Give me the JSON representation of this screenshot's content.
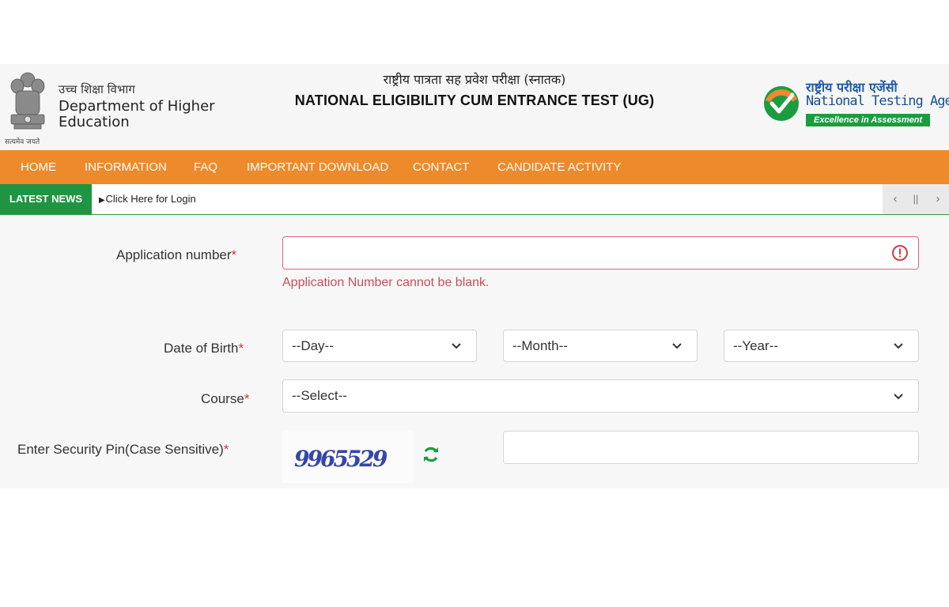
{
  "header": {
    "emblem_caption": "सत्यमेव जयते",
    "dept_hindi": "उच्च शिक्षा विभाग",
    "dept_english": "Department of Higher Education",
    "title_hindi": "राष्ट्रीय पात्रता सह प्रवेश परीक्षा (स्नातक)",
    "title_english": "NATIONAL ELIGIBILITY CUM ENTRANCE TEST (UG)",
    "nta_hindi": "राष्ट्रीय परीक्षा एजेंसी",
    "nta_english": "National Testing Agency",
    "nta_tagline": "Excellence in Assessment",
    "nta_colors": {
      "blue": "#1a5aa8",
      "green": "#1b9d3f",
      "orange": "#ec8a2c"
    }
  },
  "nav": {
    "items": [
      {
        "label": "HOME"
      },
      {
        "label": "INFORMATION"
      },
      {
        "label": "FAQ"
      },
      {
        "label": "IMPORTANT DOWNLOAD"
      },
      {
        "label": "CONTACT"
      },
      {
        "label": "CANDIDATE ACTIVITY"
      }
    ],
    "background": "#ec8a2c"
  },
  "news": {
    "label": "LATEST NEWS",
    "item": "Click Here for Login",
    "controls": {
      "prev": "‹",
      "pause": "||",
      "next": "›"
    }
  },
  "form": {
    "application_label": "Application number",
    "application_value": "",
    "application_error": "Application Number cannot be blank.",
    "dob_label": "Date of Birth",
    "day_value": "--Day--",
    "month_value": "--Month--",
    "year_value": "--Year--",
    "course_label": "Course",
    "course_value": "--Select--",
    "pin_label": "Enter Security Pin(Case Sensitive)",
    "captcha_text": "9965529",
    "pin_value": "",
    "required_marker": "*"
  }
}
